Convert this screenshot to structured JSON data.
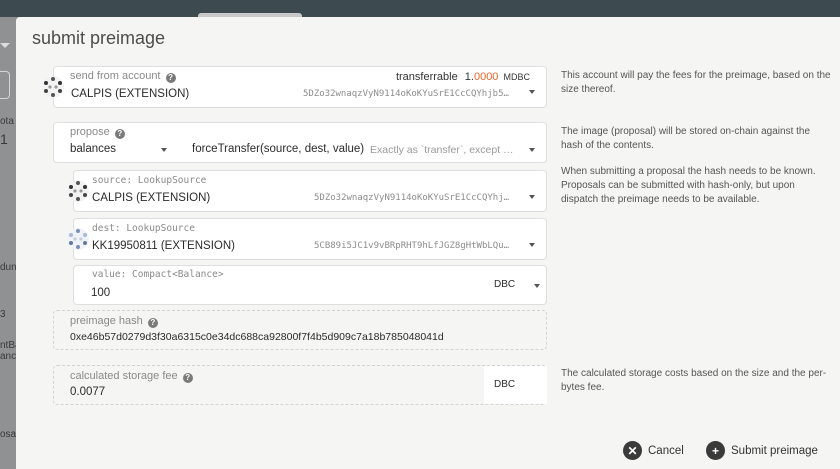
{
  "background": {
    "left_fragments": [
      "ota",
      "1",
      "dun",
      "3",
      "ntBa",
      "ance",
      "osal"
    ]
  },
  "modal": {
    "title": "submit preimage",
    "send_from": {
      "label": "send from account",
      "account_name": "CALPIS (EXTENSION)",
      "address": "5DZo32wnaqzVyN9114oKoKYuSrE1CcCQYhjb5…",
      "transferrable_label": "transferrable",
      "transferrable_int": "1.",
      "transferrable_dec": "0000",
      "transferrable_unit": "MDBC"
    },
    "propose": {
      "label": "propose",
      "section": "balances",
      "method": "forceTransfer(source, dest, value)",
      "description": "Exactly as `transfer`, except …"
    },
    "source": {
      "label": "source: LookupSource",
      "account_name": "CALPIS (EXTENSION)",
      "address": "5DZo32wnaqzVyN9114oKoKYuSrE1CcCQYhj…"
    },
    "dest": {
      "label": "dest: LookupSource",
      "account_name": "KK19950811 (EXTENSION)",
      "address": "5CB89i5JC1v9vBRpRHT9hLfJGZ8gHtWbLQu…"
    },
    "value": {
      "label": "value: Compact<Balance>",
      "amount": "100",
      "unit": "DBC"
    },
    "preimage_hash": {
      "label": "preimage hash",
      "value": "0xe46b57d0279d3f30a6315c0e34dc688ca92800f7f4b5d909c7a18b785048041d"
    },
    "storage_fee": {
      "label": "calculated storage fee",
      "value": "0.0077",
      "unit": "DBC"
    },
    "help_texts": {
      "send_from": "This account will pay the fees for the preimage, based on the size thereof.",
      "propose": "The image (proposal) will be stored on-chain against the hash of the contents.",
      "proposal_hash": "When submitting a proposal the hash needs to be known. Proposals can be submitted with hash-only, but upon dispatch the preimage needs to be available.",
      "storage_fee": "The calculated storage costs based on the size and the per-bytes fee."
    },
    "buttons": {
      "cancel": "Cancel",
      "submit": "Submit preimage"
    }
  }
}
